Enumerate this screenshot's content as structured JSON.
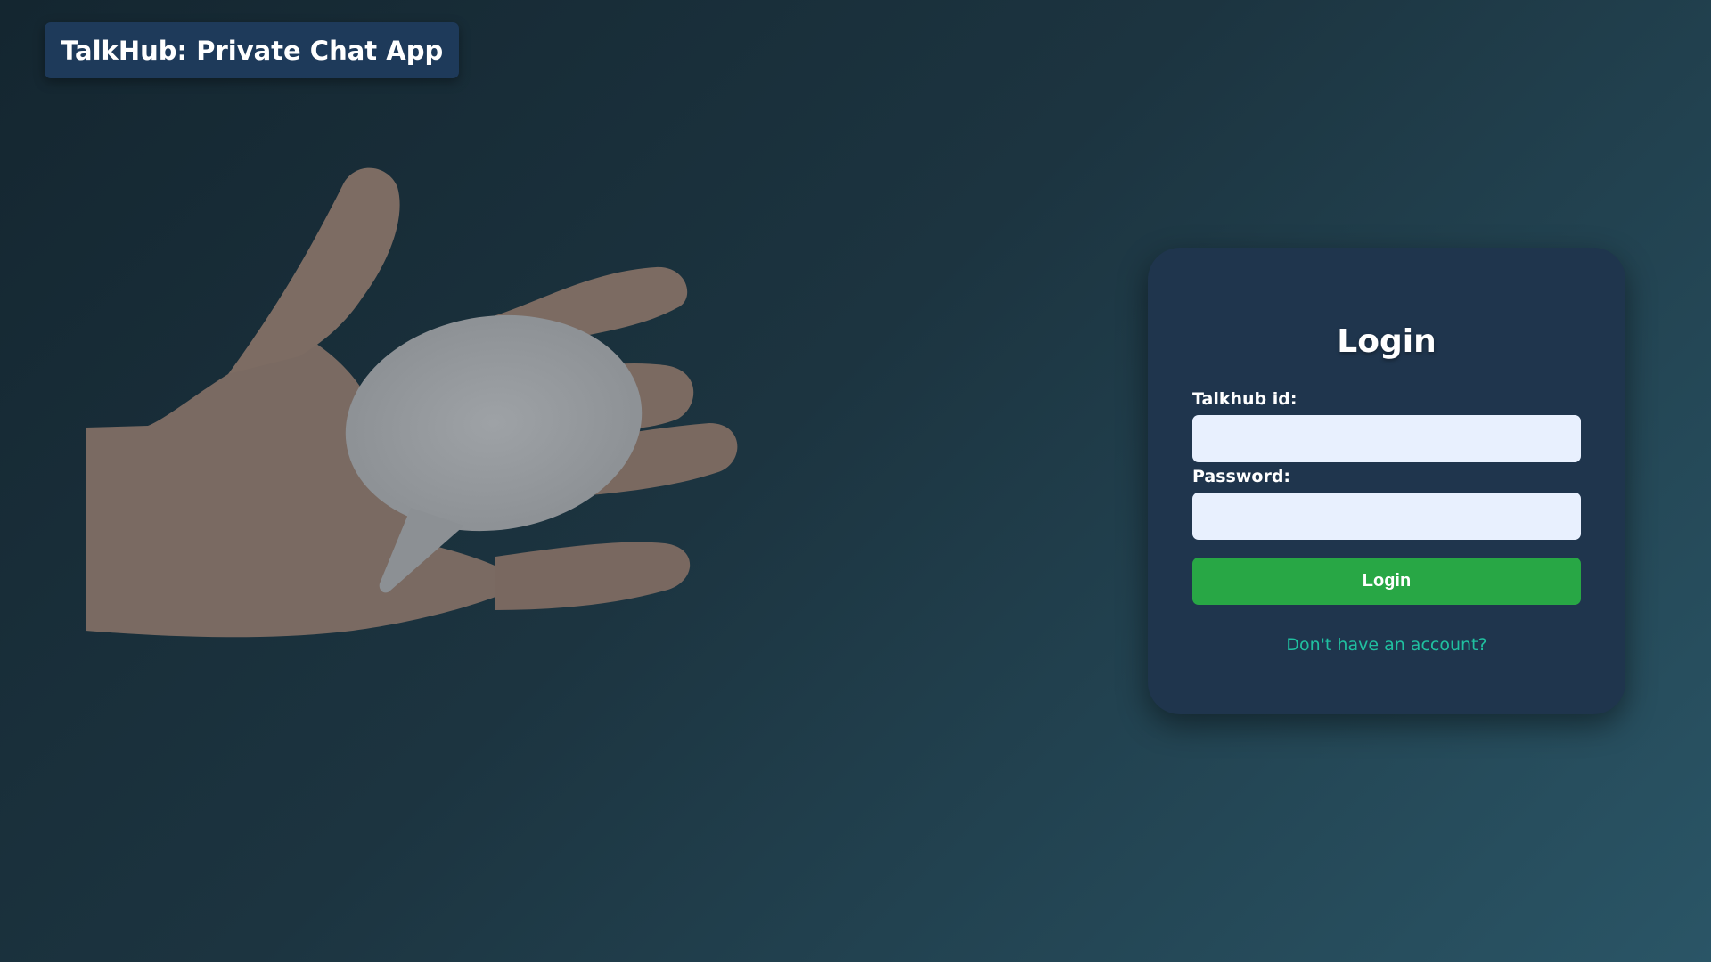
{
  "header": {
    "title": "TalkHub: Private Chat App"
  },
  "hero": {
    "icon": "hand-holding-speech-bubble"
  },
  "login": {
    "heading": "Login",
    "id_label": "Talkhub id:",
    "id_value": "",
    "password_label": "Password:",
    "password_value": "",
    "submit_label": "Login",
    "signup_link": "Don't have an account?"
  },
  "colors": {
    "title_bg": "#1e3a5a",
    "card_bg": "#1f354d",
    "input_bg": "#e8f0fe",
    "button": "#28a745",
    "link": "#20c0a0"
  }
}
